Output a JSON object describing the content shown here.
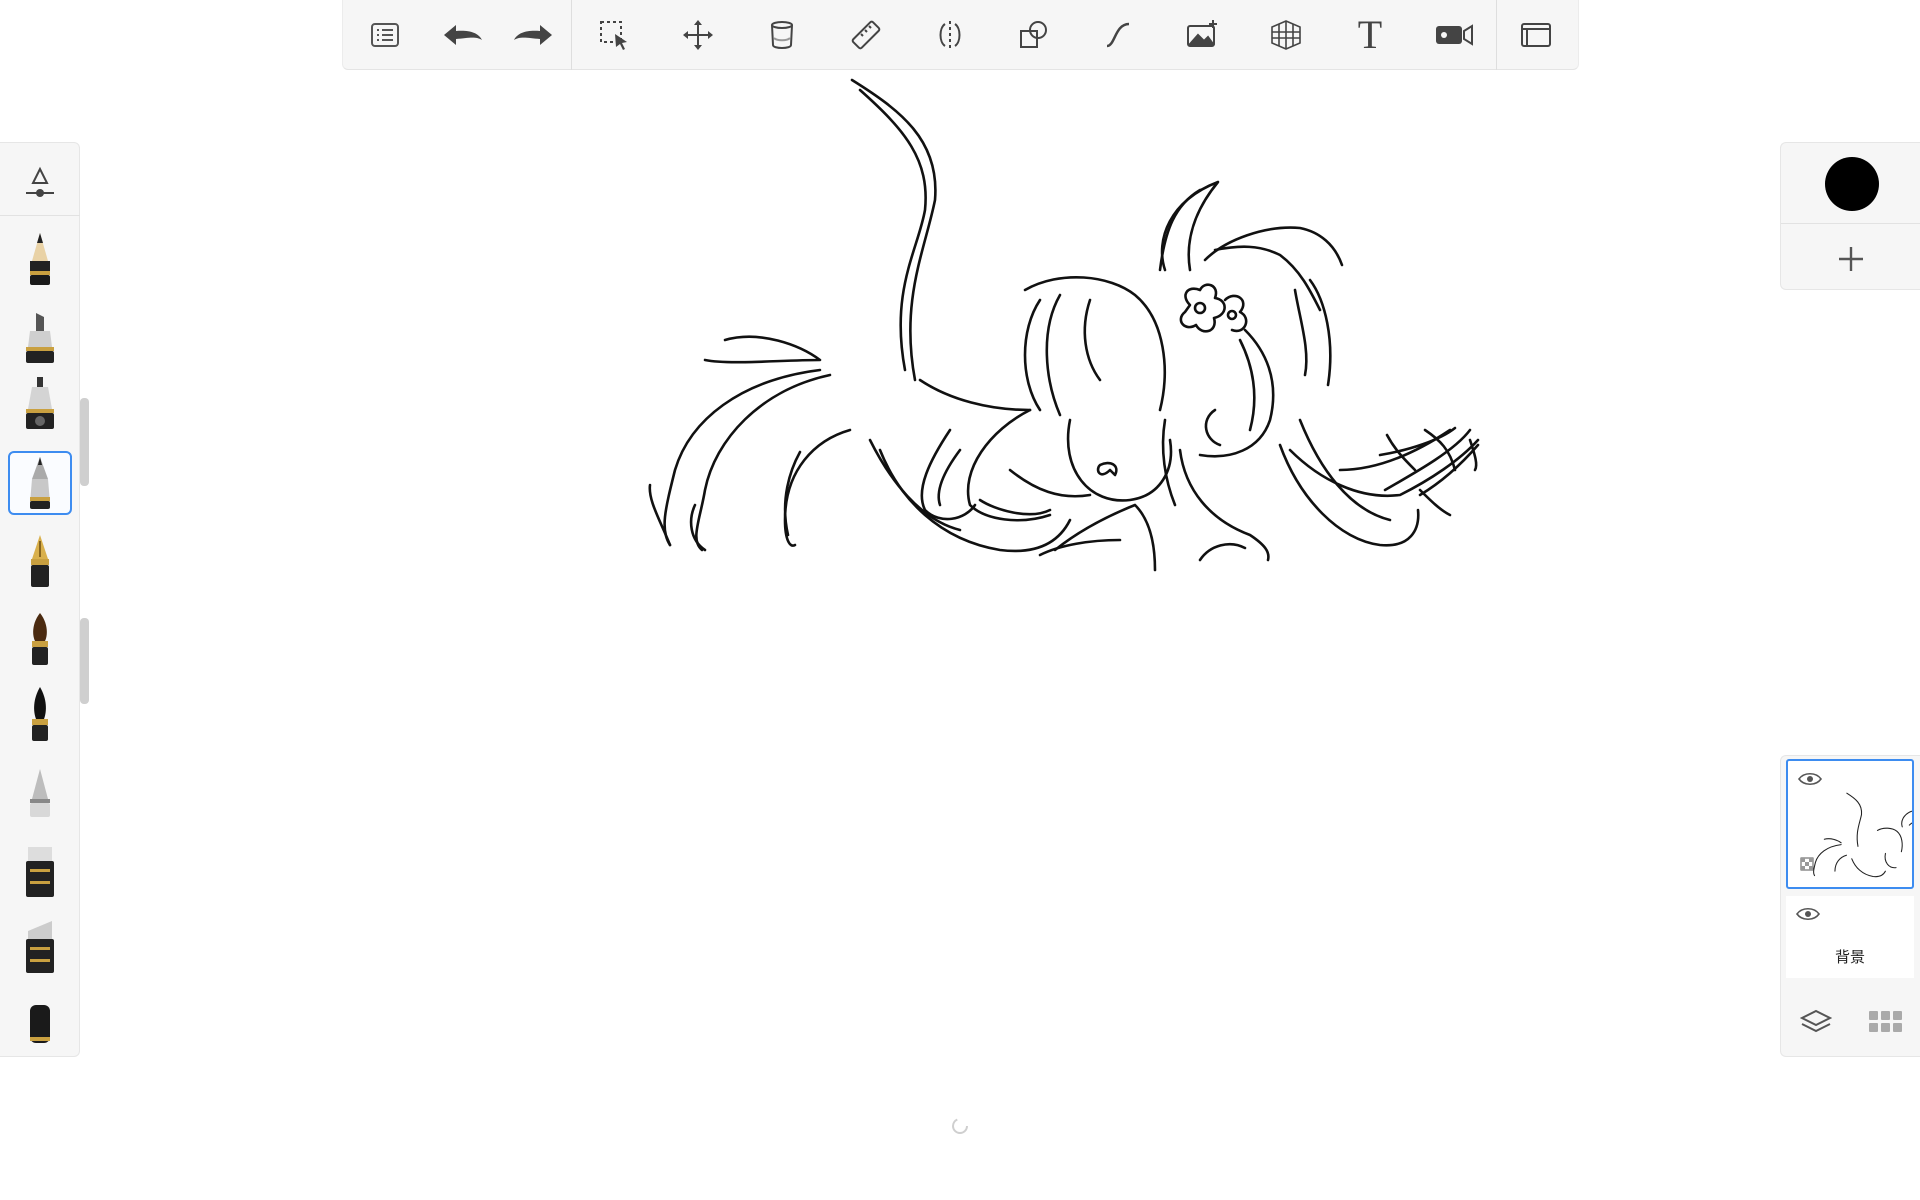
{
  "toolbar": {
    "left": [
      {
        "name": "menu-list-icon"
      },
      {
        "name": "undo-icon"
      },
      {
        "name": "redo-icon"
      }
    ],
    "tools": [
      {
        "name": "selection-icon"
      },
      {
        "name": "transform-icon"
      },
      {
        "name": "fill-bucket-icon"
      },
      {
        "name": "ruler-icon"
      },
      {
        "name": "symmetry-icon"
      },
      {
        "name": "shapes-icon"
      },
      {
        "name": "curve-icon"
      },
      {
        "name": "add-image-icon"
      },
      {
        "name": "perspective-grid-icon"
      },
      {
        "name": "text-icon",
        "glyph": "T"
      },
      {
        "name": "recording-icon"
      }
    ],
    "right": [
      {
        "name": "fullscreen-icon"
      }
    ]
  },
  "brushes": {
    "selected_index": 4,
    "items": [
      {
        "name": "brush-settings-icon"
      },
      {
        "name": "pencil-brush-icon"
      },
      {
        "name": "marker-brush-icon"
      },
      {
        "name": "airbrush-icon"
      },
      {
        "name": "ballpoint-brush-icon"
      },
      {
        "name": "fountain-pen-icon"
      },
      {
        "name": "paint-brush-icon"
      },
      {
        "name": "ink-brush-icon"
      },
      {
        "name": "smudge-brush-icon"
      },
      {
        "name": "chisel-marker-icon"
      },
      {
        "name": "wide-marker-icon"
      },
      {
        "name": "eraser-icon"
      }
    ]
  },
  "color": {
    "current": "#000000",
    "accent": "#3d8cf0"
  },
  "layers": {
    "items": [
      {
        "name": "layer-1",
        "label": "",
        "selected": true,
        "visible": true
      },
      {
        "name": "layer-background",
        "label": "背景",
        "selected": false,
        "visible": true
      }
    ]
  }
}
